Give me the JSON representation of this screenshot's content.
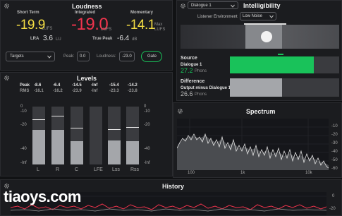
{
  "loudness": {
    "title": "Loudness",
    "short_term_label": "Short Term",
    "short_term_value": "-19.9",
    "short_term_unit": "LUFS",
    "integrated_label": "Integrated",
    "integrated_value": "-19.0",
    "integrated_unit": "LUFS",
    "momentary_label": "Momentary",
    "momentary_value": "-14.1",
    "momentary_unit_1": "Max",
    "momentary_unit_2": "LUFS",
    "lra_label": "LRA",
    "lra_value": "3.6",
    "lra_unit": "LU",
    "true_peak_label": "True Peak",
    "true_peak_value": "-6.4",
    "true_peak_unit": "dB",
    "targets_label": "Targets",
    "peak_label": "Peak:",
    "peak_value": "0.0",
    "loudness_label": "Loudness:",
    "loudness_value": "-23.0",
    "gate_label": "Gate"
  },
  "intelligibility": {
    "title": "Intelligibility",
    "dialogue_select": "Dialogue 1",
    "listener_env_label": "Listener Environment",
    "listener_env_value": "Low Noise",
    "source_label": "Source",
    "source_name": "Dialogue 1",
    "source_value": "27.2",
    "source_unit": "Phons",
    "difference_label": "Difference",
    "difference_name": "Output minus Dialogue 1",
    "difference_value": "26.6",
    "difference_unit": "Phons",
    "source_fill": 0.77,
    "difference_fill": 0.48
  },
  "levels": {
    "title": "Levels",
    "peak_label": "Peak",
    "rms_label": "RMS",
    "channels": [
      {
        "name": "L",
        "peak": "-8.6",
        "rms": "-16.1"
      },
      {
        "name": "R",
        "peak": "-6.4",
        "rms": "-16.2"
      },
      {
        "name": "C",
        "peak": "-14.5",
        "rms": "-23.9"
      },
      {
        "name": "LFE",
        "peak": "-Inf",
        "rms": "-Inf"
      },
      {
        "name": "Lss",
        "peak": "-15.4",
        "rms": "-23.3"
      },
      {
        "name": "Rss",
        "peak": "-14.2",
        "rms": "-23.8"
      }
    ],
    "scale": [
      "0",
      "-10",
      "-20",
      "-40",
      "-Inf"
    ]
  },
  "spectrum": {
    "title": "Spectrum",
    "x_ticks": [
      "100",
      "1k",
      "10k"
    ],
    "y_ticks": [
      "-10",
      "-20",
      "-30",
      "-40",
      "-50",
      "-60"
    ]
  },
  "history": {
    "title": "History",
    "y_ticks": [
      "0",
      "-20"
    ]
  },
  "watermark": "tiaoys.com",
  "colors": {
    "yellow": "#f3dd43",
    "red": "#f0344d",
    "green": "#19c25a",
    "gray_fill": "#a4a6aa"
  }
}
